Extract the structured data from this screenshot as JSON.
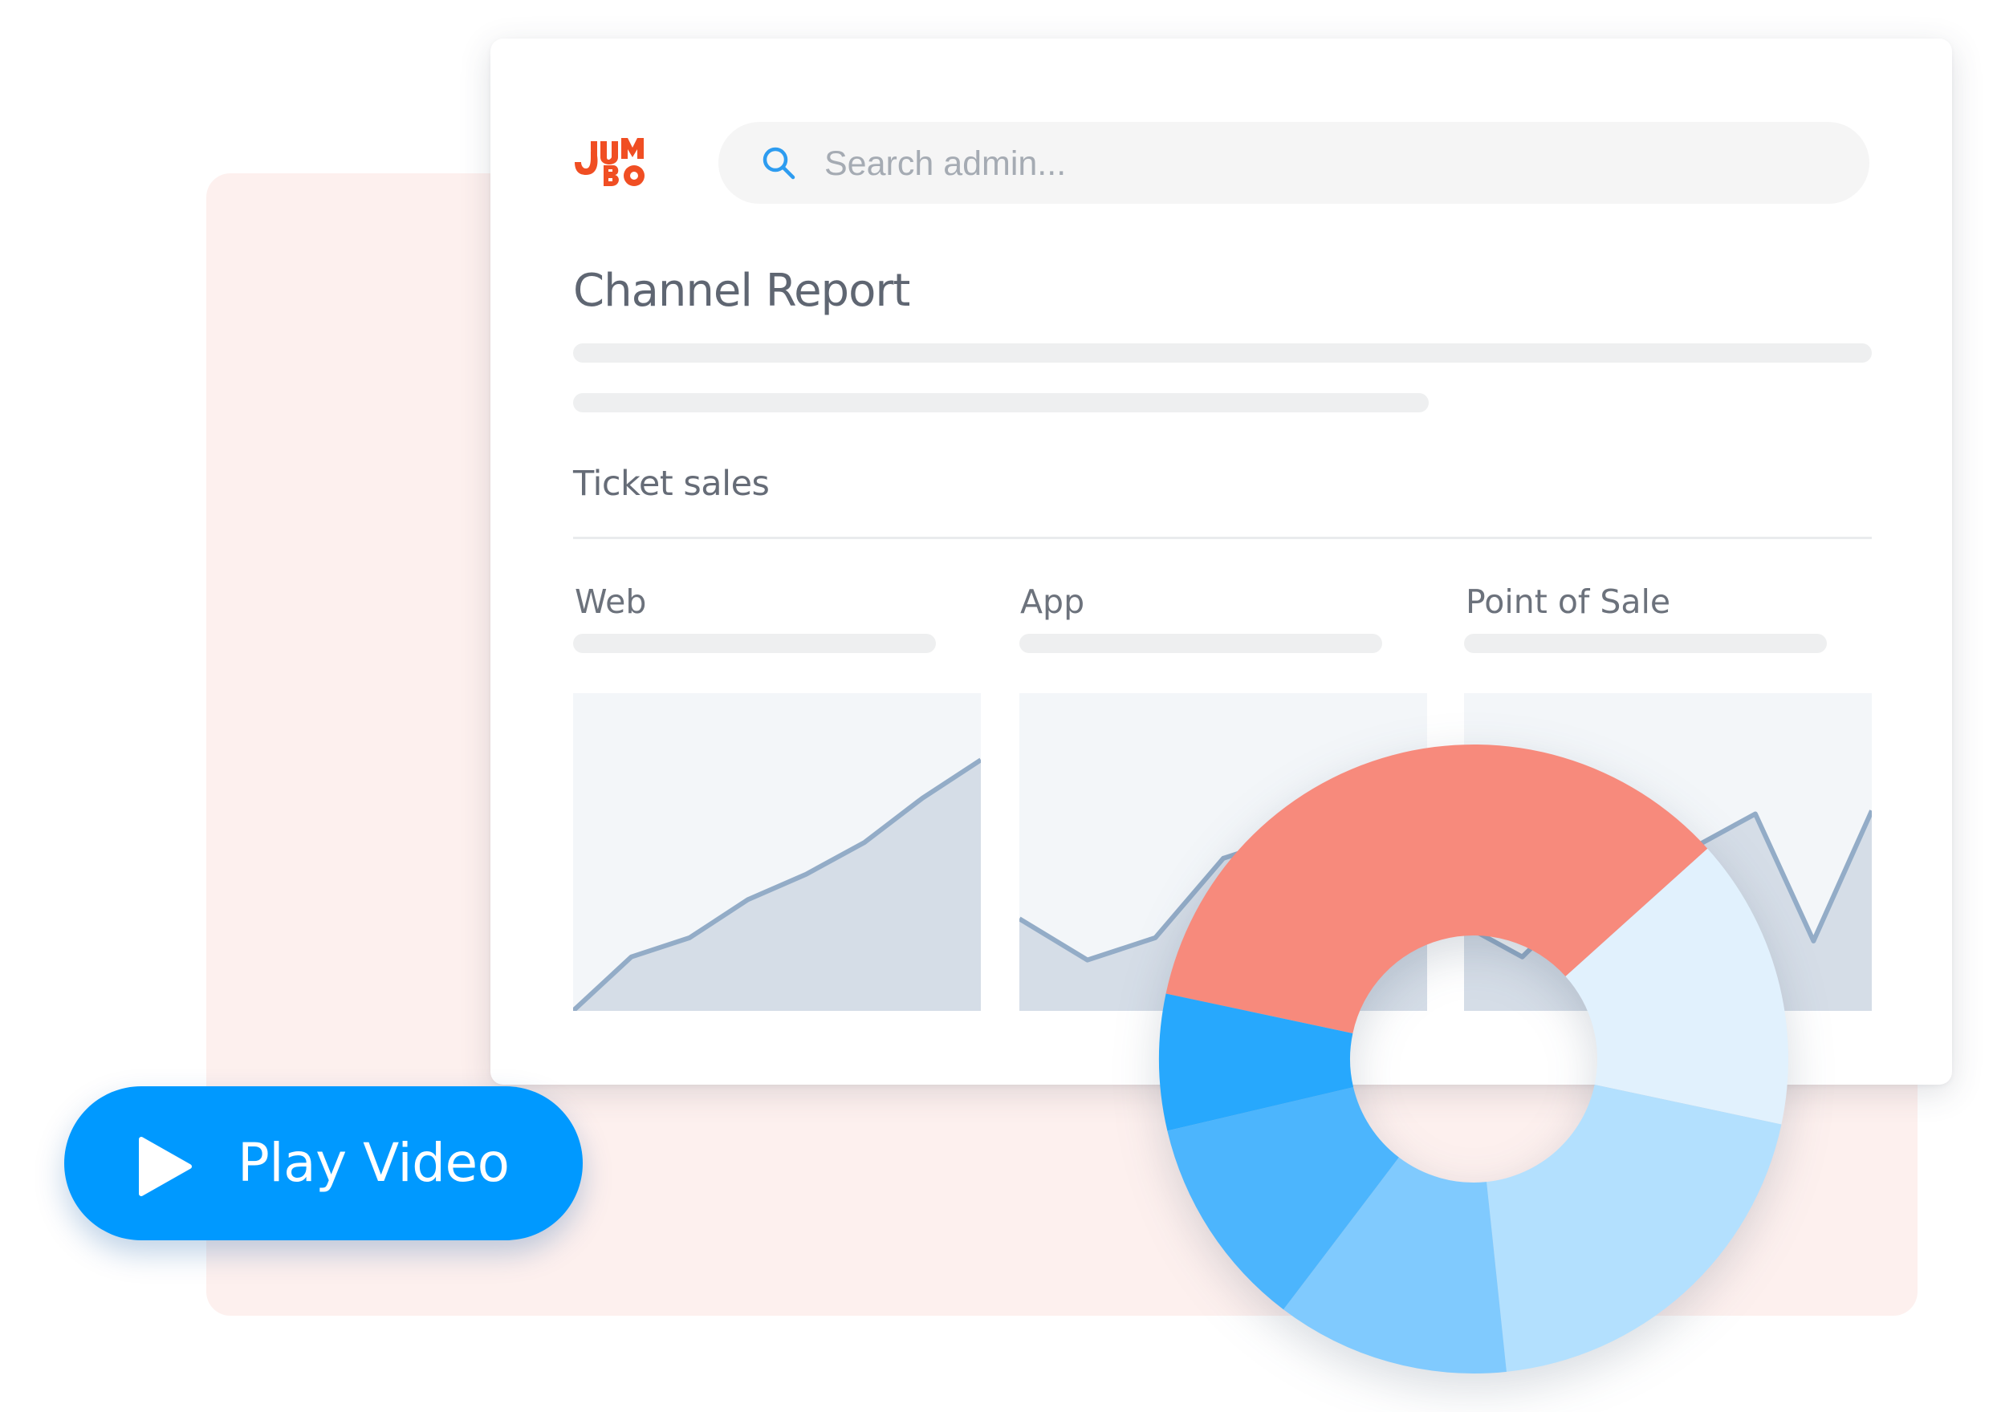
{
  "brand": {
    "logo_text": "JUMBO",
    "accent_color": "#f04e23"
  },
  "search": {
    "placeholder": "Search admin..."
  },
  "report": {
    "title": "Channel Report",
    "section_title": "Ticket sales",
    "columns": [
      {
        "label": "Web"
      },
      {
        "label": "App"
      },
      {
        "label": "Point of Sale"
      }
    ]
  },
  "chart_data": [
    {
      "type": "area",
      "series": [
        {
          "values": [
            0,
            17,
            23,
            35,
            43,
            53,
            67,
            79
          ]
        }
      ]
    },
    {
      "type": "area",
      "series": [
        {
          "values": [
            29,
            16,
            23,
            48,
            55,
            67,
            68
          ]
        }
      ]
    },
    {
      "type": "area",
      "series": [
        {
          "values": [
            27,
            17,
            35,
            42,
            52,
            62,
            22,
            63
          ]
        }
      ]
    },
    {
      "type": "pie",
      "values": [
        35,
        15,
        20,
        12,
        11,
        7
      ],
      "colors": [
        "#f78a7c",
        "#e1f1fd",
        "#b3e0fe",
        "#80cafe",
        "#4cb5fd",
        "#27a8fd"
      ]
    }
  ],
  "cta": {
    "play_label": "Play Video",
    "color": "#0099ff"
  },
  "icons": {
    "search": "search-icon",
    "play": "play-icon"
  }
}
